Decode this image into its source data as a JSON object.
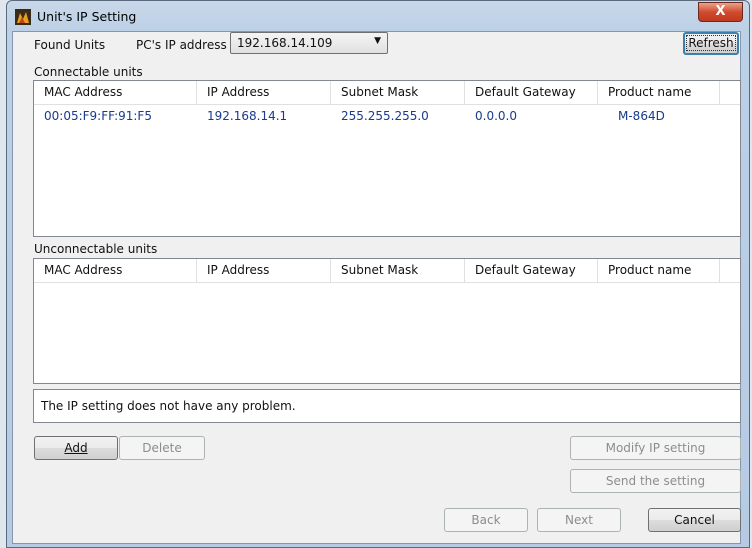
{
  "window": {
    "title": "Unit's IP Setting",
    "close_label": "X"
  },
  "top": {
    "found_units_label": "Found Units",
    "pc_ip_label": "PC's IP address",
    "pc_ip_value": "192.168.14.109",
    "refresh_label": "Refresh"
  },
  "connectable": {
    "label": "Connectable units",
    "columns": [
      "MAC Address",
      "IP Address",
      "Subnet Mask",
      "Default Gateway",
      "Product name"
    ],
    "rows": [
      [
        "00:05:F9:FF:91:F5",
        "192.168.14.1",
        "255.255.255.0",
        "0.0.0.0",
        "M-864D"
      ]
    ]
  },
  "unconnectable": {
    "label": "Unconnectable units",
    "columns": [
      "MAC Address",
      "IP Address",
      "Subnet Mask",
      "Default Gateway",
      "Product name"
    ],
    "rows": []
  },
  "status_message": "The IP setting does not have any problem.",
  "buttons": {
    "add": "Add",
    "delete": "Delete",
    "modify": "Modify IP setting",
    "send": "Send the setting",
    "back": "Back",
    "next": "Next",
    "cancel": "Cancel"
  },
  "colors": {
    "row_text": "#1a3a8c",
    "focus_border": "#3c7fb1",
    "close_button": "#c03a1d"
  }
}
